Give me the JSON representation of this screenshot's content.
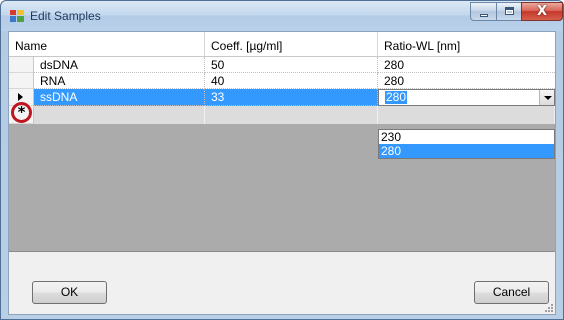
{
  "window": {
    "title": "Edit Samples"
  },
  "title_buttons": {
    "close": "X"
  },
  "grid": {
    "columns": [
      "Name",
      "Coeff. [µg/ml]",
      "Ratio-WL [nm]"
    ],
    "rows": [
      {
        "name": "dsDNA",
        "coeff": "50",
        "ratio": "280"
      },
      {
        "name": "RNA",
        "coeff": "40",
        "ratio": "280"
      },
      {
        "name": "ssDNA",
        "coeff": "33",
        "ratio": "280"
      }
    ],
    "selected_row_index": 2,
    "new_row_symbol": "*"
  },
  "ratio_dropdown": {
    "options": [
      "230",
      "280"
    ],
    "highlighted": "280"
  },
  "buttons": {
    "ok": "OK",
    "cancel": "Cancel"
  },
  "colors": {
    "selection": "#3399ff",
    "annotation_circle": "#c0141e",
    "grid_background": "#ababab"
  }
}
